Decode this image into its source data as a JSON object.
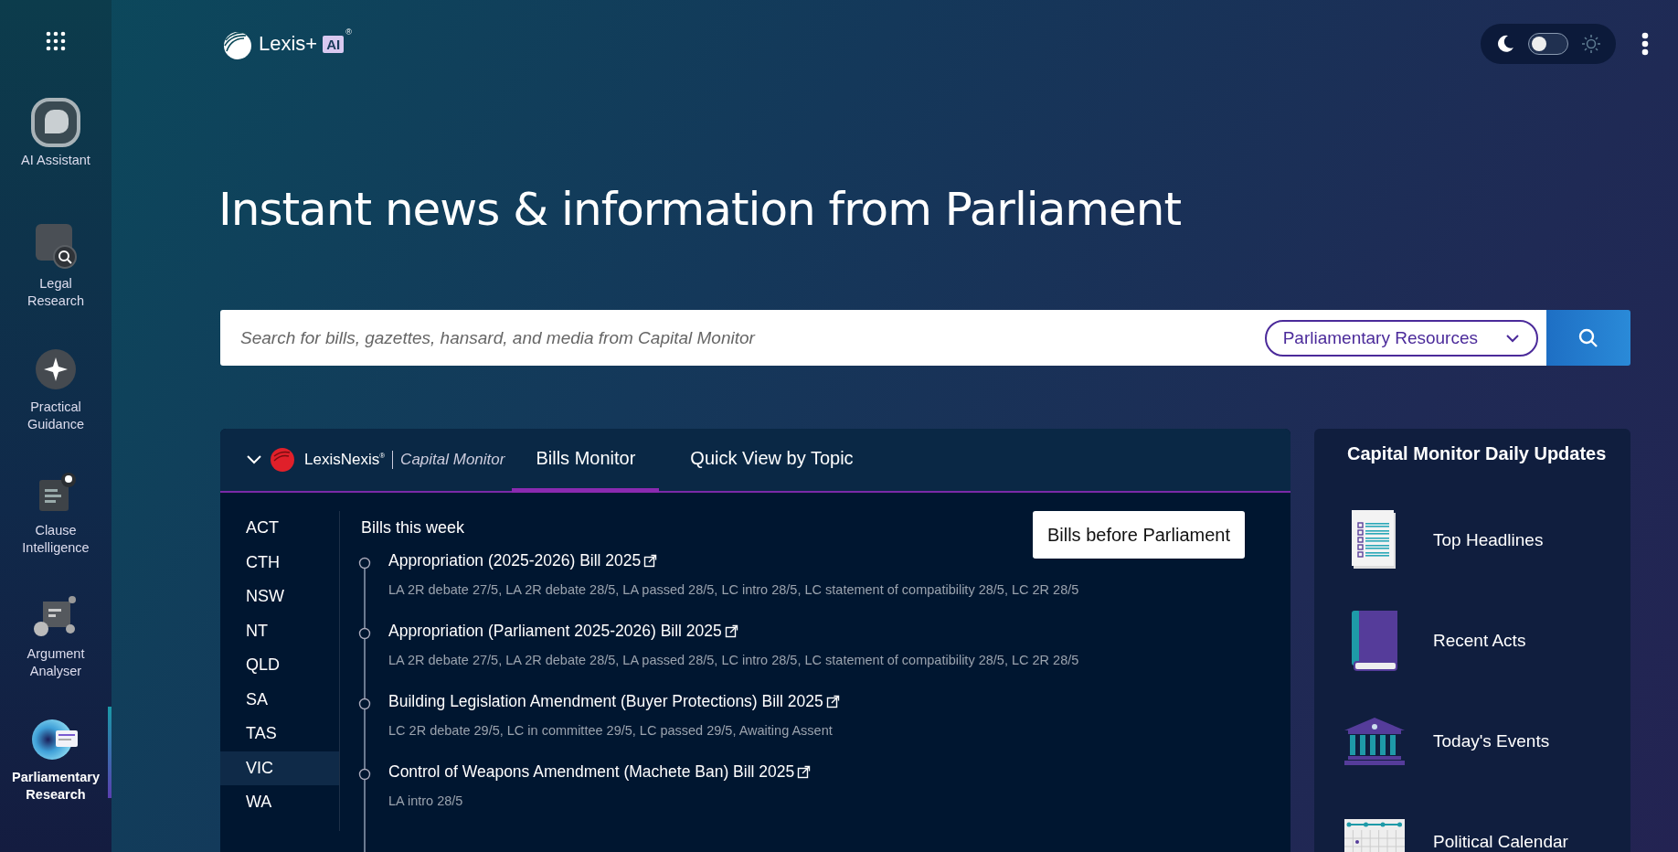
{
  "sidebar": {
    "items": [
      {
        "label": "AI Assistant",
        "selected": false
      },
      {
        "label": "Legal Research",
        "selected": false
      },
      {
        "label": "Practical Guidance",
        "selected": false
      },
      {
        "label": "Clause Intelligence",
        "selected": false
      },
      {
        "label": "Argument Analyser",
        "selected": false
      },
      {
        "label": "Parliamentary Research",
        "selected": true
      }
    ]
  },
  "logo": {
    "text": "Lexis+",
    "badge": "AI",
    "mark": "®"
  },
  "theme_toggle": {
    "light": false
  },
  "heading": "Instant news & information from Parliament",
  "search": {
    "placeholder": "Search for bills, gazettes, hansard, and media from Capital Monitor",
    "scope": "Parliamentary Resources"
  },
  "monitor": {
    "brand": "LexisNexis$^{®}$",
    "product": "Capital Monitor",
    "tabs": [
      {
        "label": "Bills Monitor",
        "selected": true
      },
      {
        "label": "Quick View by Topic",
        "selected": false
      }
    ],
    "states": [
      {
        "label": "ACT",
        "selected": false
      },
      {
        "label": "CTH",
        "selected": false
      },
      {
        "label": "NSW",
        "selected": false
      },
      {
        "label": "NT",
        "selected": false
      },
      {
        "label": "QLD",
        "selected": false
      },
      {
        "label": "SA",
        "selected": false
      },
      {
        "label": "TAS",
        "selected": false
      },
      {
        "label": "VIC",
        "selected": true
      },
      {
        "label": "WA",
        "selected": false
      }
    ],
    "section_title": "Bills this week",
    "button": "Bills before Parliament",
    "bills": [
      {
        "title": "Appropriation (2025-2026) Bill 2025",
        "status": "LA 2R debate 27/5, LA 2R debate 28/5, LA passed 28/5, LC intro 28/5, LC statement of compatibility 28/5, LC 2R 28/5"
      },
      {
        "title": "Appropriation (Parliament 2025-2026) Bill 2025",
        "status": "LA 2R debate 27/5, LA 2R debate 28/5, LA passed 28/5, LC intro 28/5, LC statement of compatibility 28/5, LC 2R 28/5"
      },
      {
        "title": "Building Legislation Amendment (Buyer Protections) Bill 2025",
        "status": "LC 2R debate 29/5, LC in committee 29/5, LC passed 29/5, Awaiting Assent"
      },
      {
        "title": "Control of Weapons Amendment (Machete Ban) Bill 2025",
        "status": "LA intro 28/5"
      }
    ]
  },
  "updates": {
    "title": "Capital Monitor Daily Updates",
    "items": [
      {
        "label": "Top Headlines"
      },
      {
        "label": "Recent Acts"
      },
      {
        "label": "Today's Events"
      },
      {
        "label": "Political Calendar"
      }
    ]
  }
}
